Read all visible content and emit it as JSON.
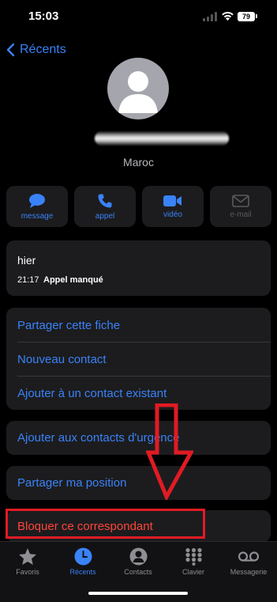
{
  "status_bar": {
    "time": "15:03",
    "battery": "79"
  },
  "nav": {
    "back_label": "Récents"
  },
  "contact": {
    "country": "Maroc"
  },
  "actions": [
    {
      "label": "message",
      "icon": "message-icon"
    },
    {
      "label": "appel",
      "icon": "phone-icon"
    },
    {
      "label": "vidéo",
      "icon": "video-icon"
    },
    {
      "label": "e-mail",
      "icon": "mail-icon"
    }
  ],
  "history": {
    "day": "hier",
    "time": "21:17",
    "type": "Appel manqué"
  },
  "options": {
    "share_contact": "Partager cette fiche",
    "new_contact": "Nouveau contact",
    "add_existing": "Ajouter à un contact existant",
    "add_emergency": "Ajouter aux contacts d'urgence",
    "share_location": "Partager ma position",
    "block_caller": "Bloquer ce correspondant"
  },
  "tabs": [
    {
      "label": "Favoris",
      "icon": "star-icon"
    },
    {
      "label": "Récents",
      "icon": "clock-icon"
    },
    {
      "label": "Contacts",
      "icon": "person-circle-icon"
    },
    {
      "label": "Clavier",
      "icon": "keypad-icon"
    },
    {
      "label": "Messagerie",
      "icon": "voicemail-icon"
    }
  ],
  "colors": {
    "accent": "#3a82f7",
    "destructive": "#ff453a",
    "highlight": "#e01b24"
  }
}
